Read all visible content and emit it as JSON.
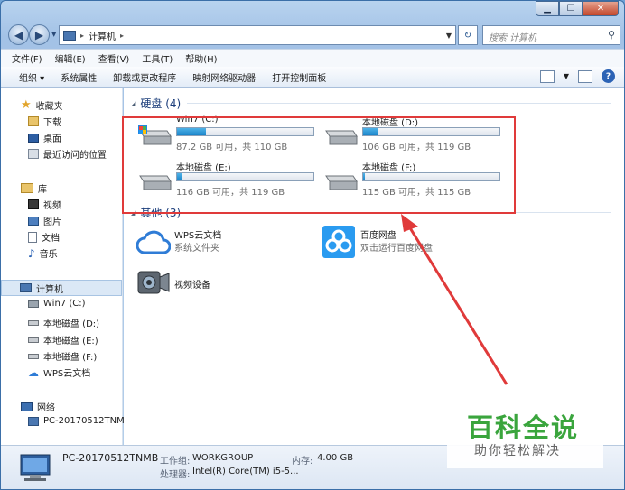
{
  "window": {
    "min": "▁",
    "max": "☐",
    "close": "✕"
  },
  "address": {
    "path": "计算机",
    "search_placeholder": "搜索 计算机"
  },
  "menu": [
    "文件(F)",
    "编辑(E)",
    "查看(V)",
    "工具(T)",
    "帮助(H)"
  ],
  "toolbar": [
    "组织 ▾",
    "系统属性",
    "卸载或更改程序",
    "映射网络驱动器",
    "打开控制面板"
  ],
  "nav": {
    "favorites": "收藏夹",
    "fav_items": [
      "下载",
      "桌面",
      "最近访问的位置"
    ],
    "libraries": "库",
    "lib_items": [
      "视频",
      "图片",
      "文档",
      "音乐"
    ],
    "computer": "计算机",
    "comp_items": [
      "Win7 (C:)",
      "本地磁盘 (D:)",
      "本地磁盘 (E:)",
      "本地磁盘 (F:)",
      "WPS云文档"
    ],
    "network": "网络",
    "net_items": [
      "PC-20170512TNM"
    ]
  },
  "groups": {
    "hdd": "硬盘 (4)",
    "other": "其他 (3)"
  },
  "drives": [
    {
      "name": "Win7 (C:)",
      "caption": "87.2 GB 可用，共 110 GB",
      "used": 0.21
    },
    {
      "name": "本地磁盘 (D:)",
      "caption": "106 GB 可用，共 119 GB",
      "used": 0.11
    },
    {
      "name": "本地磁盘 (E:)",
      "caption": "116 GB 可用，共 119 GB",
      "used": 0.03
    },
    {
      "name": "本地磁盘 (F:)",
      "caption": "115 GB 可用，共 115 GB",
      "used": 0.01
    }
  ],
  "others": [
    {
      "name": "WPS云文档",
      "sub": "系统文件夹"
    },
    {
      "name": "百度网盘",
      "sub": "双击运行百度网盘"
    },
    {
      "name": "视频设备",
      "sub": ""
    }
  ],
  "status": {
    "pc_name": "PC-20170512TNMB",
    "workgroup_label": "工作组:",
    "workgroup": "WORKGROUP",
    "memory_label": "内存:",
    "memory": "4.00 GB",
    "cpu_label": "处理器:",
    "cpu": "Intel(R) Core(TM) i5-5..."
  },
  "watermark": {
    "title": "百科全说",
    "subtitle": "助你轻松解决"
  },
  "colors": {
    "annotation": "#e03a3a",
    "watermark": "#3aa53d",
    "drive_fill": "#1a84c9"
  }
}
